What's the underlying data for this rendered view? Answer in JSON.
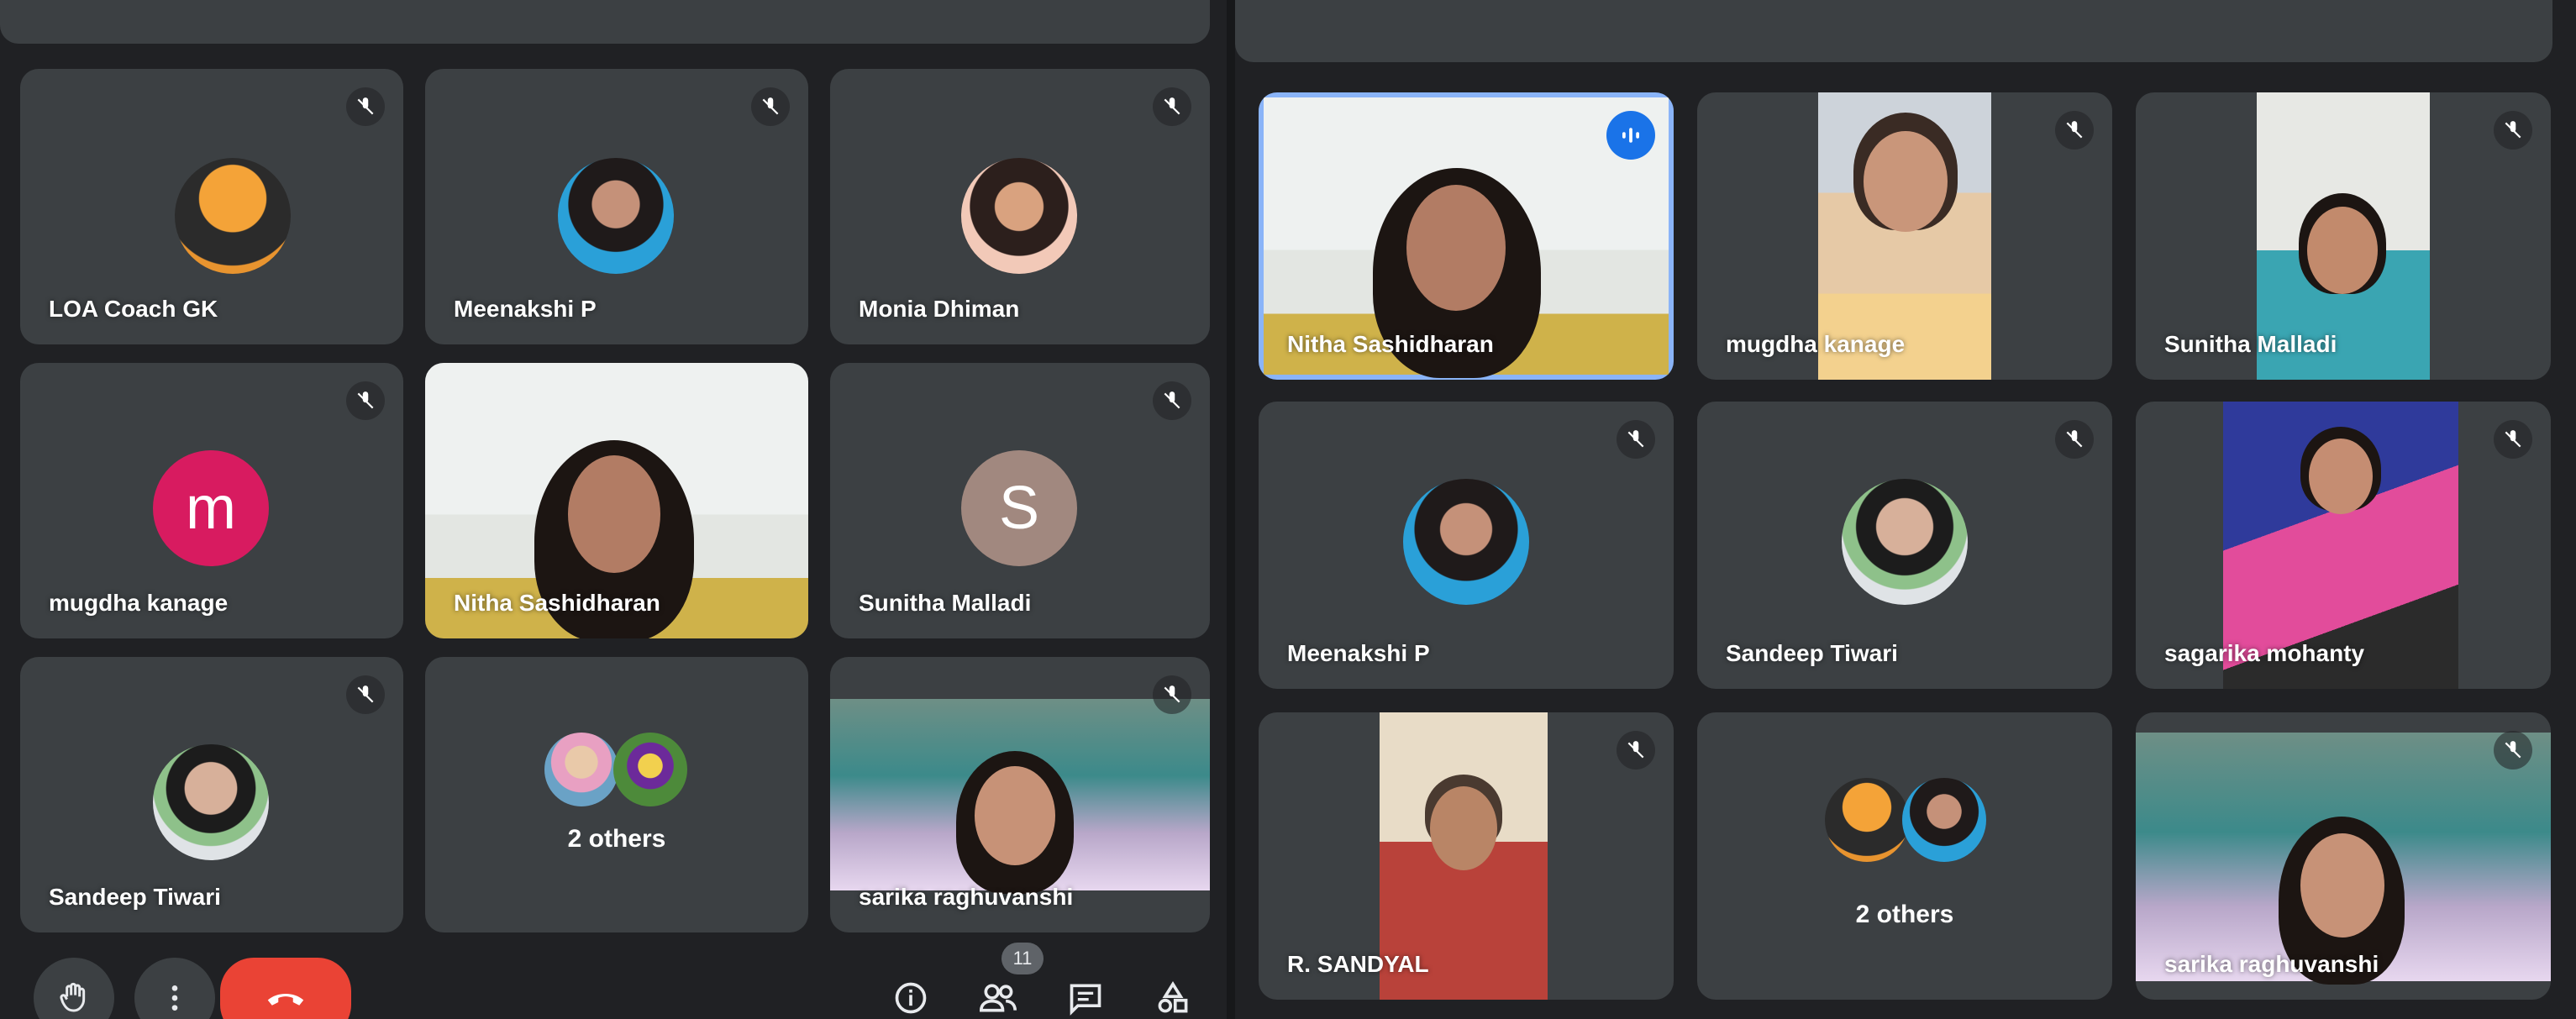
{
  "left_panel": {
    "tiles": [
      {
        "name": "LOA Coach GK",
        "type": "avatar-photo"
      },
      {
        "name": "Meenakshi P",
        "type": "avatar-photo"
      },
      {
        "name": "Monia Dhiman",
        "type": "avatar-photo"
      },
      {
        "name": "mugdha kanage",
        "type": "avatar-initial",
        "initial": "m",
        "color": "#d81b60"
      },
      {
        "name": "Nitha Sashidharan",
        "type": "video"
      },
      {
        "name": "Sunitha Malladi",
        "type": "avatar-initial",
        "initial": "S",
        "color": "#a1887f"
      },
      {
        "name": "Sandeep Tiwari",
        "type": "avatar-photo"
      },
      {
        "name": "2 others",
        "type": "others"
      },
      {
        "name": "sarika raghuvanshi",
        "type": "video"
      }
    ],
    "controls": {
      "people_count": "11",
      "icons": [
        "raise-hand-icon",
        "more-options-icon",
        "end-call-icon",
        "info-icon",
        "people-icon",
        "chat-icon",
        "activities-icon"
      ]
    }
  },
  "right_panel": {
    "tiles": [
      {
        "name": "Nitha Sashidharan",
        "type": "video",
        "speaking": true
      },
      {
        "name": "mugdha kanage",
        "type": "video"
      },
      {
        "name": "Sunitha Malladi",
        "type": "video"
      },
      {
        "name": "Meenakshi P",
        "type": "avatar-photo"
      },
      {
        "name": "Sandeep Tiwari",
        "type": "avatar-photo"
      },
      {
        "name": "sagarika mohanty",
        "type": "video"
      },
      {
        "name": "R. SANDYAL",
        "type": "video"
      },
      {
        "name": "2 others",
        "type": "others"
      },
      {
        "name": "sarika raghuvanshi",
        "type": "video"
      }
    ]
  },
  "colors": {
    "background": "#202124",
    "tile": "#3c4043",
    "speaking_border": "#8ab4f8",
    "end_call": "#ea4335"
  }
}
